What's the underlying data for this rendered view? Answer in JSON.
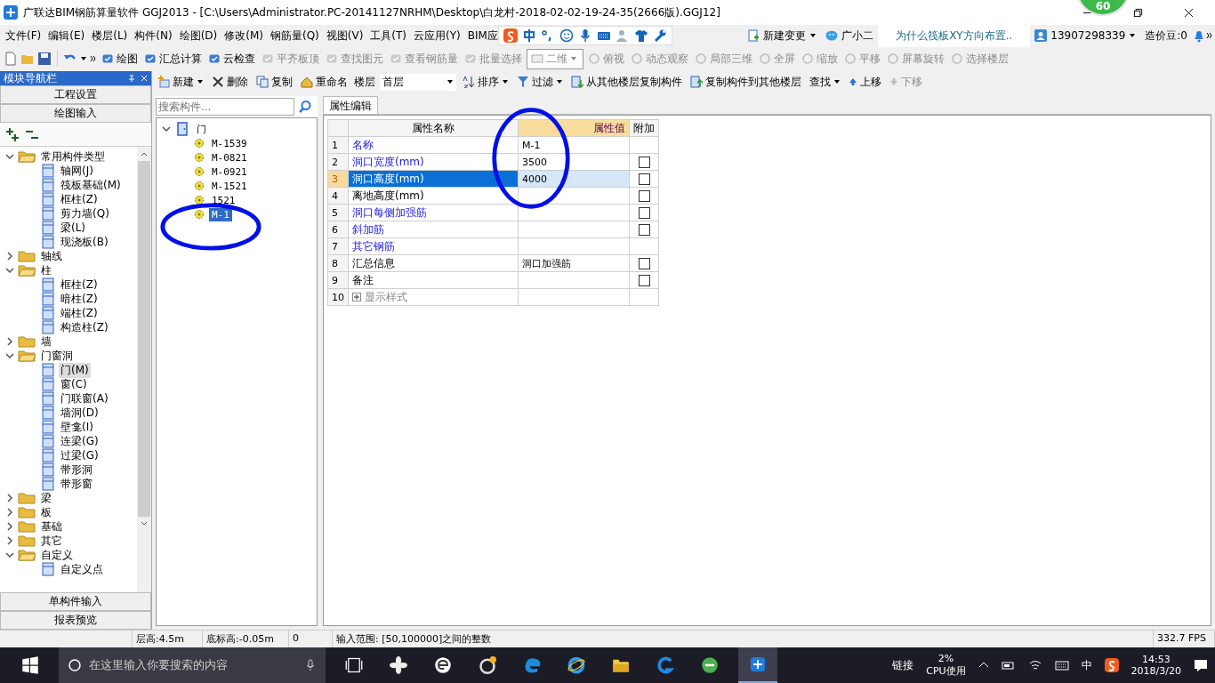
{
  "window": {
    "title": "广联达BIM钢筋算量软件 GGJ2013 - [C:\\Users\\Administrator.PC-20141127NRHM\\Desktop\\白龙村-2018-02-02-19-24-35(2666版).GGJ12]",
    "badge": "60"
  },
  "menu": [
    "文件(F)",
    "编辑(E)",
    "楼层(L)",
    "构件(N)",
    "绘图(D)",
    "修改(M)",
    "钢筋量(Q)",
    "视图(V)",
    "工具(T)",
    "云应用(Y)",
    "BIM应"
  ],
  "menu_right": {
    "change": "新建变更",
    "assistant": "广小二",
    "tip": "为什么筏板XY方向布置..",
    "user": "13907298339",
    "beans": "造价豆:0"
  },
  "toolbar": [
    {
      "label": "绘图",
      "disabled": false
    },
    {
      "label": "汇总计算",
      "disabled": false
    },
    {
      "label": "云检查",
      "disabled": false
    },
    {
      "label": "平齐板顶",
      "disabled": true
    },
    {
      "label": "查找图元",
      "disabled": true
    },
    {
      "label": "查看钢筋量",
      "disabled": true
    },
    {
      "label": "批量选择",
      "disabled": true
    }
  ],
  "view_select": "二维",
  "view_tools": [
    {
      "label": "俯视",
      "disabled": true
    },
    {
      "label": "动态观察",
      "disabled": true
    },
    {
      "label": "局部三维",
      "disabled": true
    },
    {
      "label": "全屏",
      "disabled": true
    },
    {
      "label": "缩放",
      "disabled": true
    },
    {
      "label": "平移",
      "disabled": true
    },
    {
      "label": "屏幕旋转",
      "disabled": true
    },
    {
      "label": "选择楼层",
      "disabled": true
    }
  ],
  "nav": {
    "title": "模块导航栏",
    "top_buttons": [
      "工程设置",
      "绘图输入"
    ],
    "bottom_buttons": [
      "单构件输入",
      "报表预览"
    ],
    "tree": [
      {
        "label": "常用构件类型",
        "expanded": true,
        "selected": false,
        "children": [
          {
            "label": "轴网(J)",
            "selected": false
          },
          {
            "label": "筏板基础(M)",
            "selected": false
          },
          {
            "label": "框柱(Z)",
            "selected": false
          },
          {
            "label": "剪力墙(Q)",
            "selected": false
          },
          {
            "label": "梁(L)",
            "selected": false
          },
          {
            "label": "现浇板(B)",
            "selected": false
          }
        ]
      },
      {
        "label": "轴线",
        "expanded": false,
        "selected": false
      },
      {
        "label": "柱",
        "expanded": true,
        "selected": false,
        "children": [
          {
            "label": "框柱(Z)",
            "selected": false
          },
          {
            "label": "暗柱(Z)",
            "selected": false
          },
          {
            "label": "端柱(Z)",
            "selected": false
          },
          {
            "label": "构造柱(Z)",
            "selected": false
          }
        ]
      },
      {
        "label": "墙",
        "expanded": false,
        "selected": false
      },
      {
        "label": "门窗洞",
        "expanded": true,
        "selected": false,
        "children": [
          {
            "label": "门(M)",
            "selected": true
          },
          {
            "label": "窗(C)",
            "selected": false
          },
          {
            "label": "门联窗(A)",
            "selected": false
          },
          {
            "label": "墙洞(D)",
            "selected": false
          },
          {
            "label": "壁龛(I)",
            "selected": false
          },
          {
            "label": "连梁(G)",
            "selected": false
          },
          {
            "label": "过梁(G)",
            "selected": false
          },
          {
            "label": "带形洞",
            "selected": false
          },
          {
            "label": "带形窗",
            "selected": false
          }
        ]
      },
      {
        "label": "梁",
        "expanded": false,
        "selected": false
      },
      {
        "label": "板",
        "expanded": false,
        "selected": false
      },
      {
        "label": "基础",
        "expanded": false,
        "selected": false
      },
      {
        "label": "其它",
        "expanded": false,
        "selected": false
      },
      {
        "label": "自定义",
        "expanded": true,
        "selected": false,
        "children": [
          {
            "label": "自定义点",
            "selected": false
          }
        ]
      }
    ]
  },
  "component_toolbar": {
    "new": "新建",
    "delete": "删除",
    "copy": "复制",
    "rename": "重命名",
    "floor_label": "楼层",
    "floor": "首层",
    "sort": "排序",
    "filter": "过滤",
    "copy_from": "从其他楼层复制构件",
    "copy_to": "复制构件到其他楼层",
    "find": "查找",
    "up": "上移",
    "down": "下移",
    "down_disabled": true
  },
  "component_search": {
    "placeholder": "搜索构件..."
  },
  "component_tree": [
    {
      "label": "门",
      "expanded": true,
      "selected": false,
      "children": [
        {
          "label": "M-1539",
          "selected": false
        },
        {
          "label": "M-0821",
          "selected": false
        },
        {
          "label": "M-0921",
          "selected": false
        },
        {
          "label": "M-1521",
          "selected": false
        },
        {
          "label": "1521",
          "selected": false
        },
        {
          "label": "M-1",
          "selected": true
        }
      ]
    }
  ],
  "property_tab": "属性编辑",
  "properties": {
    "columns": [
      "属性名称",
      "属性值",
      "附加"
    ],
    "rows": [
      {
        "num": "1",
        "name": "名称",
        "value": "M-1",
        "public": true,
        "selected": false
      },
      {
        "num": "2",
        "name": "洞口宽度(mm)",
        "value": "3500",
        "public": true,
        "checked": false,
        "selected": false
      },
      {
        "num": "3",
        "name": "洞口高度(mm)",
        "value": "4000",
        "public": true,
        "checked": false,
        "selected": true
      },
      {
        "num": "4",
        "name": "离地高度(mm)",
        "public": false,
        "checked": false,
        "selected": false
      },
      {
        "num": "5",
        "name": "洞口每侧加强筋",
        "public": true,
        "checked": false,
        "selected": false
      },
      {
        "num": "6",
        "name": "斜加筋",
        "public": true,
        "checked": false,
        "selected": false
      },
      {
        "num": "7",
        "name": "其它钢筋",
        "public": true,
        "selected": false
      },
      {
        "num": "8",
        "name": "汇总信息",
        "value": "洞口加强筋",
        "public": false,
        "checked": false,
        "selected": false
      },
      {
        "num": "9",
        "name": "备注",
        "public": false,
        "checked": false,
        "selected": false
      },
      {
        "num": "10",
        "name": "显示样式",
        "kind": "group",
        "selected": false
      }
    ]
  },
  "status_bar": [
    "层高:4.5m",
    "底标高:-0.05m",
    "0",
    "输入范围: [50,100000]之间的整数",
    "332.7 FPS"
  ],
  "taskbar": {
    "search_placeholder": "在这里输入你要搜索的内容",
    "tray_link": "链接",
    "cpu_value": "2%",
    "cpu_label": "CPU使用",
    "ime": "中",
    "time": "14:53",
    "date": "2018/3/20"
  }
}
